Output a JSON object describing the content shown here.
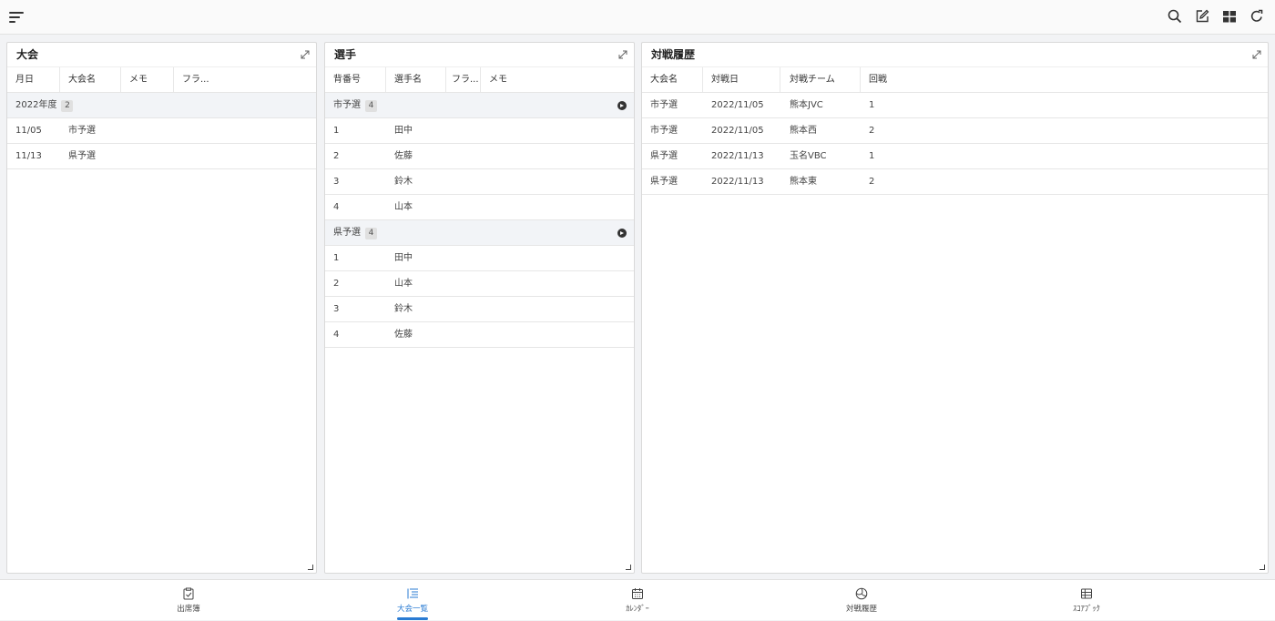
{
  "colors": {
    "accent": "#2a7bd3",
    "group_bg": "#f2f4f7",
    "panel_bg": "#ffffff"
  },
  "topbar": {
    "icons": [
      "menu-icon",
      "search-icon",
      "edit-icon",
      "grid-icon",
      "refresh-icon"
    ]
  },
  "tournament_panel": {
    "title": "大会",
    "columns": [
      "月日",
      "大会名",
      "メモ",
      "フラ..."
    ],
    "group": {
      "label": "2022年度",
      "count": "2"
    },
    "rows": [
      {
        "date": "11/05",
        "name": "市予選"
      },
      {
        "date": "11/13",
        "name": "県予選"
      }
    ]
  },
  "players_panel": {
    "title": "選手",
    "columns": [
      "背番号",
      "選手名",
      "フラ...",
      "メモ"
    ],
    "groups": [
      {
        "label": "市予選",
        "count": "4",
        "rows": [
          {
            "number": "1",
            "name": "田中"
          },
          {
            "number": "2",
            "name": "佐藤"
          },
          {
            "number": "3",
            "name": "鈴木"
          },
          {
            "number": "4",
            "name": "山本"
          }
        ]
      },
      {
        "label": "県予選",
        "count": "4",
        "rows": [
          {
            "number": "1",
            "name": "田中"
          },
          {
            "number": "2",
            "name": "山本"
          },
          {
            "number": "3",
            "name": "鈴木"
          },
          {
            "number": "4",
            "name": "佐藤"
          }
        ]
      }
    ]
  },
  "history_panel": {
    "title": "対戦履歴",
    "columns": [
      "大会名",
      "対戦日",
      "対戦チーム",
      "回戦"
    ],
    "rows": [
      {
        "tournament": "市予選",
        "date": "2022/11/05",
        "team": "熊本JVC",
        "round": "1"
      },
      {
        "tournament": "市予選",
        "date": "2022/11/05",
        "team": "熊本西",
        "round": "2"
      },
      {
        "tournament": "県予選",
        "date": "2022/11/13",
        "team": "玉名VBC",
        "round": "1"
      },
      {
        "tournament": "県予選",
        "date": "2022/11/13",
        "team": "熊本東",
        "round": "2"
      }
    ]
  },
  "bottom_nav": {
    "items": [
      {
        "label": "出席簿",
        "icon": "clipboard-check-icon"
      },
      {
        "label": "大会一覧",
        "icon": "list-icon",
        "active": true
      },
      {
        "label": "ｶﾚﾝﾀﾞｰ",
        "icon": "calendar-icon"
      },
      {
        "label": "対戦履歴",
        "icon": "volleyball-icon"
      },
      {
        "label": "ｽｺｱﾌﾞｯｸ",
        "icon": "table-icon"
      }
    ]
  }
}
